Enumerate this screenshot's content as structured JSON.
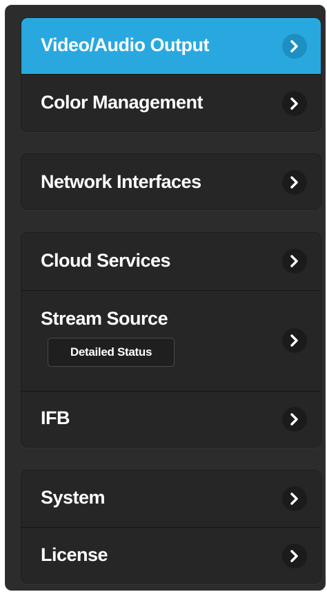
{
  "menu": {
    "groups": [
      {
        "items": [
          {
            "label": "Video/Audio Output",
            "active": true,
            "icon": "chevron-right-icon"
          },
          {
            "label": "Color Management",
            "icon": "chevron-right-icon"
          }
        ]
      },
      {
        "items": [
          {
            "label": "Network Interfaces",
            "icon": "chevron-right-icon"
          }
        ]
      },
      {
        "items": [
          {
            "label": "Cloud Services",
            "icon": "chevron-right-icon"
          },
          {
            "label": "Stream Source",
            "button": "Detailed Status",
            "icon": "chevron-right-icon"
          },
          {
            "label": "IFB",
            "icon": "chevron-right-icon"
          }
        ]
      },
      {
        "items": [
          {
            "label": "System",
            "icon": "chevron-right-icon"
          },
          {
            "label": "License",
            "icon": "chevron-right-icon"
          }
        ]
      }
    ]
  },
  "colors": {
    "active": "#29a8e0",
    "panel": "#2c2c2c",
    "group": "#262626"
  }
}
